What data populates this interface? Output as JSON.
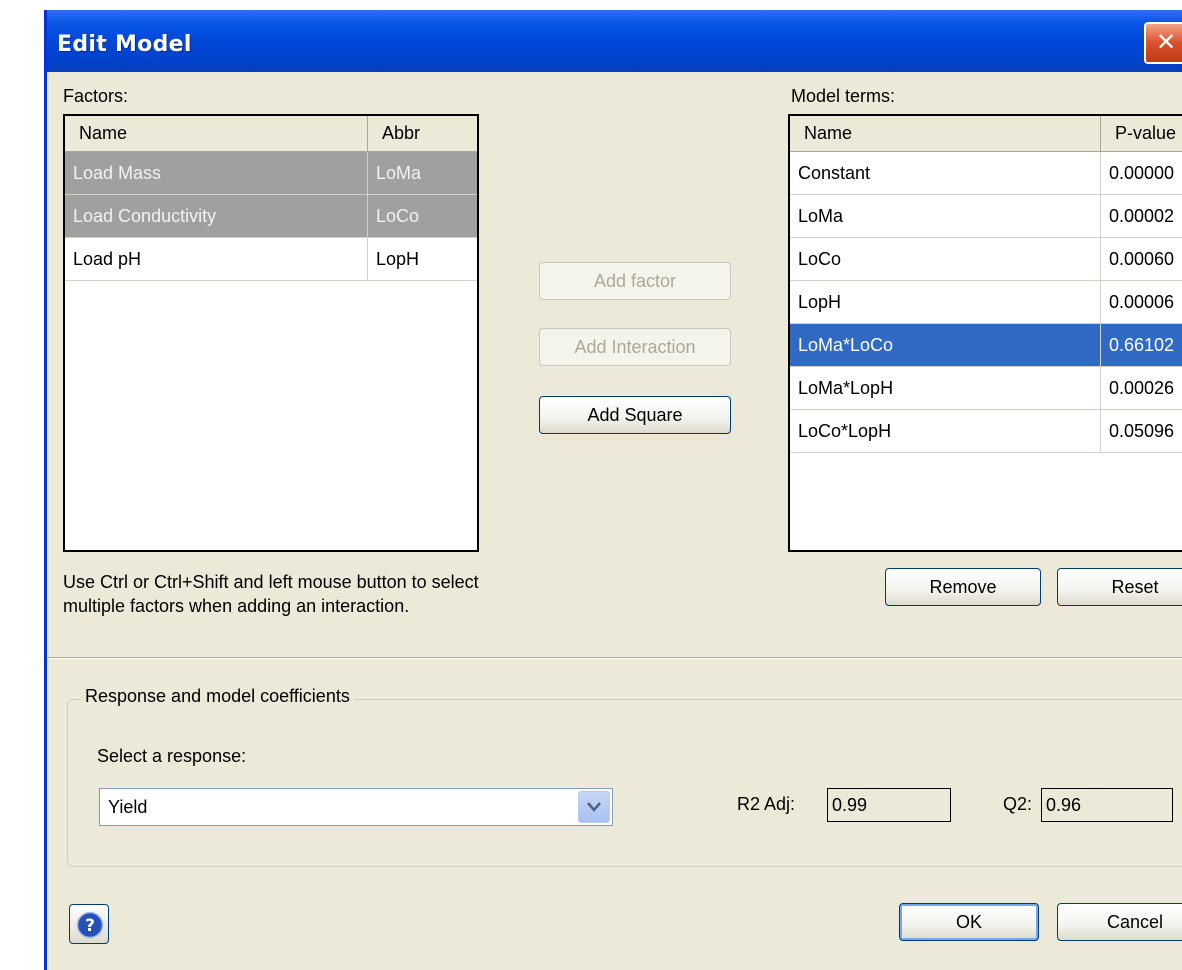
{
  "window": {
    "title": "Edit Model",
    "close_glyph": "✕"
  },
  "factors": {
    "label": "Factors:",
    "columns": [
      "Name",
      "Abbr"
    ],
    "rows": [
      {
        "name": "Load Mass",
        "abbr": "LoMa",
        "selected": true
      },
      {
        "name": "Load Conductivity",
        "abbr": "LoCo",
        "selected": true
      },
      {
        "name": "Load pH",
        "abbr": "LopH",
        "selected": false
      }
    ]
  },
  "actions": {
    "add_factor": "Add factor",
    "add_interaction": "Add Interaction",
    "add_square": "Add Square"
  },
  "model_terms": {
    "label": "Model terms:",
    "columns": [
      "Name",
      "P-value"
    ],
    "rows": [
      {
        "name": "Constant",
        "pvalue": "0.00000"
      },
      {
        "name": "LoMa",
        "pvalue": "0.00002"
      },
      {
        "name": "LoCo",
        "pvalue": "0.00060"
      },
      {
        "name": "LopH",
        "pvalue": "0.00006"
      },
      {
        "name": "LoMa*LoCo",
        "pvalue": "0.66102",
        "selected": true
      },
      {
        "name": "LoMa*LopH",
        "pvalue": "0.00026"
      },
      {
        "name": "LoCo*LopH",
        "pvalue": "0.05096"
      }
    ],
    "remove": "Remove",
    "reset": "Reset"
  },
  "hint": {
    "line1": "Use Ctrl or Ctrl+Shift and left mouse button to select",
    "line2": "multiple factors when adding an interaction."
  },
  "response": {
    "group_title": "Response and  model coefficients",
    "select_label": "Select a response:",
    "selected": "Yield",
    "r2adj_label": "R2 Adj:",
    "r2adj_value": "0.99",
    "q2_label": "Q2:",
    "q2_value": "0.96"
  },
  "footer": {
    "ok": "OK",
    "cancel": "Cancel"
  },
  "colors": {
    "titlebar": "#0146d8",
    "selection_blue": "#316ac5",
    "selection_grey": "#a0a0a0",
    "dialog_bg": "#ece9d8"
  },
  "icons": {
    "help": "help-icon",
    "dropdown": "chevron-down-icon",
    "close": "close-icon"
  }
}
